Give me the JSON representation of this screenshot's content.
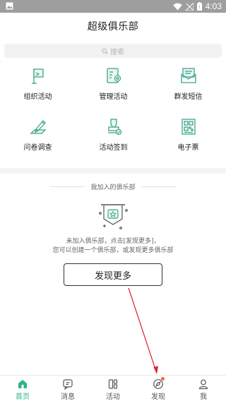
{
  "status_bar": {
    "time": "4:03",
    "icons": [
      "image-icon",
      "wifi-icon",
      "signal-icon",
      "battery-icon"
    ]
  },
  "header": {
    "title": "超级俱乐部"
  },
  "search": {
    "placeholder": "搜索",
    "icon": "search-icon"
  },
  "features": [
    {
      "label": "组织活动",
      "icon": "flag-icon"
    },
    {
      "label": "管理活动",
      "icon": "manage-settings-icon"
    },
    {
      "label": "群发短信",
      "icon": "mail-icon"
    },
    {
      "label": "问卷调查",
      "icon": "survey-pen-icon"
    },
    {
      "label": "活动签到",
      "icon": "checkin-stamp-icon"
    },
    {
      "label": "电子票",
      "icon": "qr-ticket-icon"
    }
  ],
  "clubs": {
    "header": "我加入的俱乐部",
    "empty_line1": "未加入俱乐部，点击[发现更多]，",
    "empty_line2": "您可以创建一个俱乐部，或发现更多俱乐部",
    "discover_button": "发现更多"
  },
  "tabbar": {
    "tabs": [
      {
        "label": "首页",
        "icon": "home-icon",
        "active": true
      },
      {
        "label": "消息",
        "icon": "message-icon",
        "active": false
      },
      {
        "label": "活动",
        "icon": "activity-icon",
        "active": false
      },
      {
        "label": "发现",
        "icon": "compass-icon",
        "active": false,
        "badge": true
      },
      {
        "label": "我",
        "icon": "user-icon",
        "active": false
      }
    ]
  },
  "colors": {
    "accent": "#2bb58a",
    "icon_green": "#3aa58a",
    "badge_dot": "#f06a3c",
    "arrow": "#d9232d"
  }
}
